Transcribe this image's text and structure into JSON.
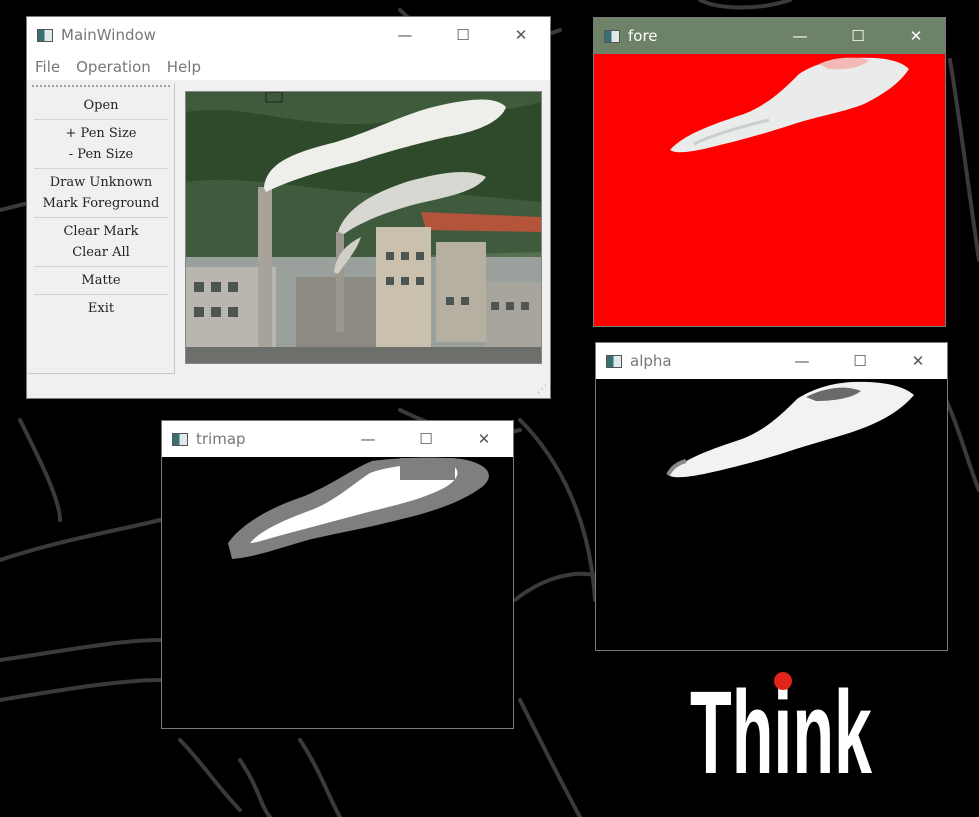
{
  "main_window": {
    "title": "MainWindow",
    "menu": [
      "File",
      "Operation",
      "Help"
    ],
    "buttons": {
      "open": "Open",
      "pen_size_up": "+ Pen Size",
      "pen_size_down": "- Pen Size",
      "draw_unknown": "Draw Unknown",
      "mark_foreground": "Mark Foreground",
      "clear_mark": "Clear Mark",
      "clear_all": "Clear All",
      "matte": "Matte",
      "exit": "Exit"
    }
  },
  "fore_window": {
    "title": "fore"
  },
  "alpha_window": {
    "title": "alpha"
  },
  "trimap_window": {
    "title": "trimap"
  },
  "window_controls": {
    "minimize": "—",
    "maximize": "☐",
    "close": "✕"
  },
  "wallpaper": {
    "brand_logo_text": "Think",
    "dot_color": "#e1251b"
  },
  "colors": {
    "fore_background": "#ff0000",
    "fore_titlebar": "#6e8268"
  }
}
